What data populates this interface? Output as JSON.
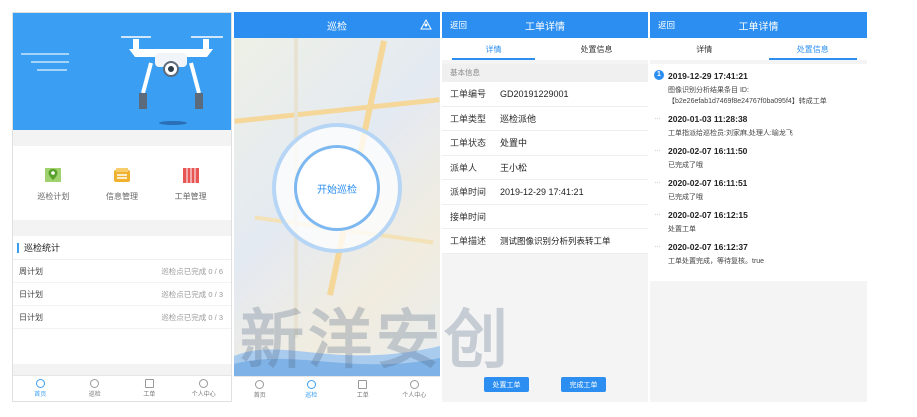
{
  "screen1": {
    "menu": [
      {
        "label": "巡检计划",
        "icon": "map-pin-icon",
        "color": "#7cc24a"
      },
      {
        "label": "信息管理",
        "icon": "info-box-icon",
        "color": "#f0b12e"
      },
      {
        "label": "工单管理",
        "icon": "workorder-icon",
        "color": "#e85555"
      }
    ],
    "stats_title": "巡检统计",
    "stats": [
      {
        "name": "周计划",
        "value": "巡检点已完成 0 / 6"
      },
      {
        "name": "日计划",
        "value": "巡检点已完成 0 / 3"
      },
      {
        "name": "日计划",
        "value": "巡检点已完成 0 / 3"
      }
    ],
    "tabs": [
      "首页",
      "巡检",
      "工单",
      "个人中心"
    ]
  },
  "screen2": {
    "title": "巡检",
    "start_label": "开始巡检",
    "tabs": [
      "首页",
      "巡检",
      "工单",
      "个人中心"
    ]
  },
  "screen3": {
    "back": "返回",
    "title": "工单详情",
    "subtabs": [
      "详情",
      "处置信息"
    ],
    "section": "基本信息",
    "fields": [
      {
        "k": "工单编号",
        "v": "GD20191229001"
      },
      {
        "k": "工单类型",
        "v": "巡检派他"
      },
      {
        "k": "工单状态",
        "v": "处置中"
      },
      {
        "k": "派单人",
        "v": "王小松"
      },
      {
        "k": "派单时间",
        "v": "2019-12-29 17:41:21"
      },
      {
        "k": "接单时间",
        "v": ""
      },
      {
        "k": "工单描述",
        "v": "测试图像识别分析列表转工单"
      }
    ],
    "btn_handle": "处置工单",
    "btn_finish": "完成工单"
  },
  "screen4": {
    "back": "返回",
    "title": "工单详情",
    "subtabs": [
      "详情",
      "处置信息"
    ],
    "timeline": [
      {
        "time": "2019-12-29 17:41:21",
        "marker": "1",
        "desc": "图像识别分析结果条目 ID:【b2e26efab1d7469f8e24767f0ba095f4】转成工单"
      },
      {
        "time": "2020-01-03 11:28:38",
        "marker": "…",
        "desc": "工单指派给巡检员:刘家麻,处理人:喻龙飞"
      },
      {
        "time": "2020-02-07 16:11:50",
        "marker": "…",
        "desc": "已完成了哦"
      },
      {
        "time": "2020-02-07 16:11:51",
        "marker": "…",
        "desc": "已完成了哦"
      },
      {
        "time": "2020-02-07 16:12:15",
        "marker": "…",
        "desc": "处置工单"
      },
      {
        "time": "2020-02-07 16:12:37",
        "marker": "…",
        "desc": "工单处置完成，等待复核。true"
      }
    ]
  },
  "watermark": "新洋安创",
  "colors": {
    "primary": "#2b8ef0",
    "hero": "#3a9ff2"
  }
}
